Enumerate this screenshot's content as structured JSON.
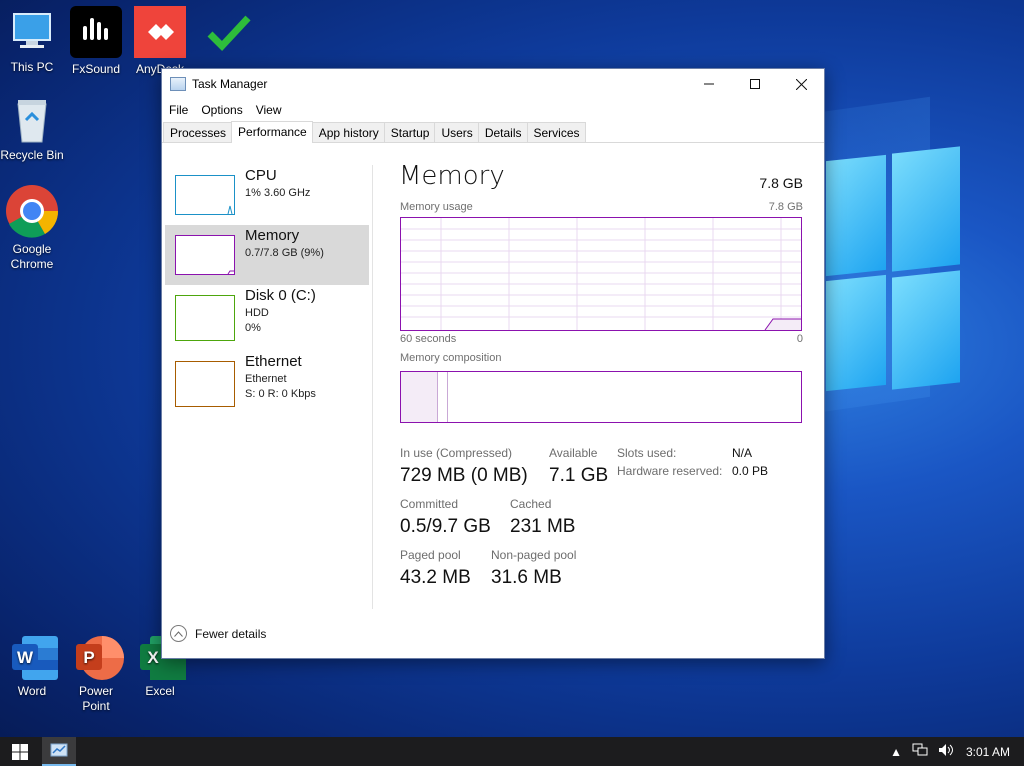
{
  "desktop": {
    "icons": [
      {
        "label": "This PC"
      },
      {
        "label": "FxSound"
      },
      {
        "label": "AnyDesk"
      },
      {
        "label": "Recycle Bin"
      },
      {
        "label": "Google Chrome"
      },
      {
        "label": "Word"
      },
      {
        "label": "Power Point"
      },
      {
        "label": "Excel"
      }
    ]
  },
  "window": {
    "title": "Task Manager",
    "menu": [
      "File",
      "Options",
      "View"
    ],
    "tabs": [
      "Processes",
      "Performance",
      "App history",
      "Startup",
      "Users",
      "Details",
      "Services"
    ],
    "active_tab": "Performance"
  },
  "sidebar": {
    "items": [
      {
        "name": "CPU",
        "sub1": "1%  3.60 GHz",
        "sub2": "",
        "color": "#1b91c7"
      },
      {
        "name": "Memory",
        "sub1": "0.7/7.8 GB (9%)",
        "sub2": "",
        "color": "#8b12ae"
      },
      {
        "name": "Disk 0 (C:)",
        "sub1": "HDD",
        "sub2": "0%",
        "color": "#4da60c"
      },
      {
        "name": "Ethernet",
        "sub1": "Ethernet",
        "sub2": "S: 0 R: 0 Kbps",
        "color": "#a75c00"
      }
    ]
  },
  "memory": {
    "title": "Memory",
    "total": "7.8 GB",
    "usage_label": "Memory usage",
    "usage_max": "7.8 GB",
    "time_left": "60 seconds",
    "time_right": "0",
    "composition_label": "Memory composition",
    "stats": {
      "in_use_label": "In use (Compressed)",
      "in_use_value": "729 MB (0 MB)",
      "available_label": "Available",
      "available_value": "7.1 GB",
      "committed_label": "Committed",
      "committed_value": "0.5/9.7 GB",
      "cached_label": "Cached",
      "cached_value": "231 MB",
      "paged_label": "Paged pool",
      "paged_value": "43.2 MB",
      "nonpaged_label": "Non-paged pool",
      "nonpaged_value": "31.6 MB",
      "slots_label": "Slots used:",
      "slots_value": "N/A",
      "hw_label": "Hardware reserved:",
      "hw_value": "0.0 PB"
    }
  },
  "footer": {
    "label": "Fewer details"
  },
  "taskbar": {
    "time": "3:01 AM"
  },
  "colors": {
    "memory_accent": "#8b12ae",
    "taskbar": "#1c1c1e"
  }
}
